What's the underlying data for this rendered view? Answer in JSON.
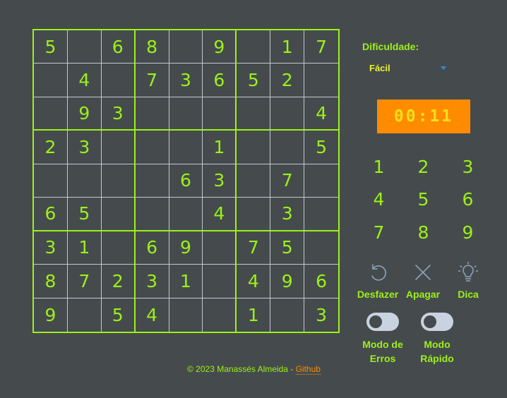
{
  "board": [
    [
      "5",
      "",
      "6",
      "8",
      "",
      "9",
      "",
      "1",
      "7"
    ],
    [
      "",
      "4",
      "",
      "7",
      "3",
      "6",
      "5",
      "2",
      ""
    ],
    [
      "",
      "9",
      "3",
      "",
      "",
      "",
      "",
      "",
      "4"
    ],
    [
      "2",
      "3",
      "",
      "",
      "",
      "1",
      "",
      "",
      "5"
    ],
    [
      "",
      "",
      "",
      "",
      "6",
      "3",
      "",
      "7",
      ""
    ],
    [
      "6",
      "5",
      "",
      "",
      "",
      "4",
      "",
      "3",
      ""
    ],
    [
      "3",
      "1",
      "",
      "6",
      "9",
      "",
      "7",
      "5",
      ""
    ],
    [
      "8",
      "7",
      "2",
      "3",
      "1",
      "",
      "4",
      "9",
      "6"
    ],
    [
      "9",
      "",
      "5",
      "4",
      "",
      "",
      "1",
      "",
      "3"
    ]
  ],
  "difficulty": {
    "label": "Dificuldade:",
    "selected": "Fácil"
  },
  "timer": "00:11",
  "numpad": [
    "1",
    "2",
    "3",
    "4",
    "5",
    "6",
    "7",
    "8",
    "9"
  ],
  "actions": {
    "undo": "Desfazer",
    "erase": "Apagar",
    "hint": "Dica"
  },
  "modes": {
    "errors": "Modo de Erros",
    "fast": "Modo Rápido"
  },
  "footer": {
    "text": "© 2023 Manassés Almeida - ",
    "link": "Github"
  },
  "colors": {
    "accent": "#9cf01a",
    "timer_bg": "#ff8c00",
    "background": "#454b4c"
  },
  "icons": {
    "undo": "undo-icon",
    "erase": "close-icon",
    "hint": "lightbulb-icon"
  }
}
